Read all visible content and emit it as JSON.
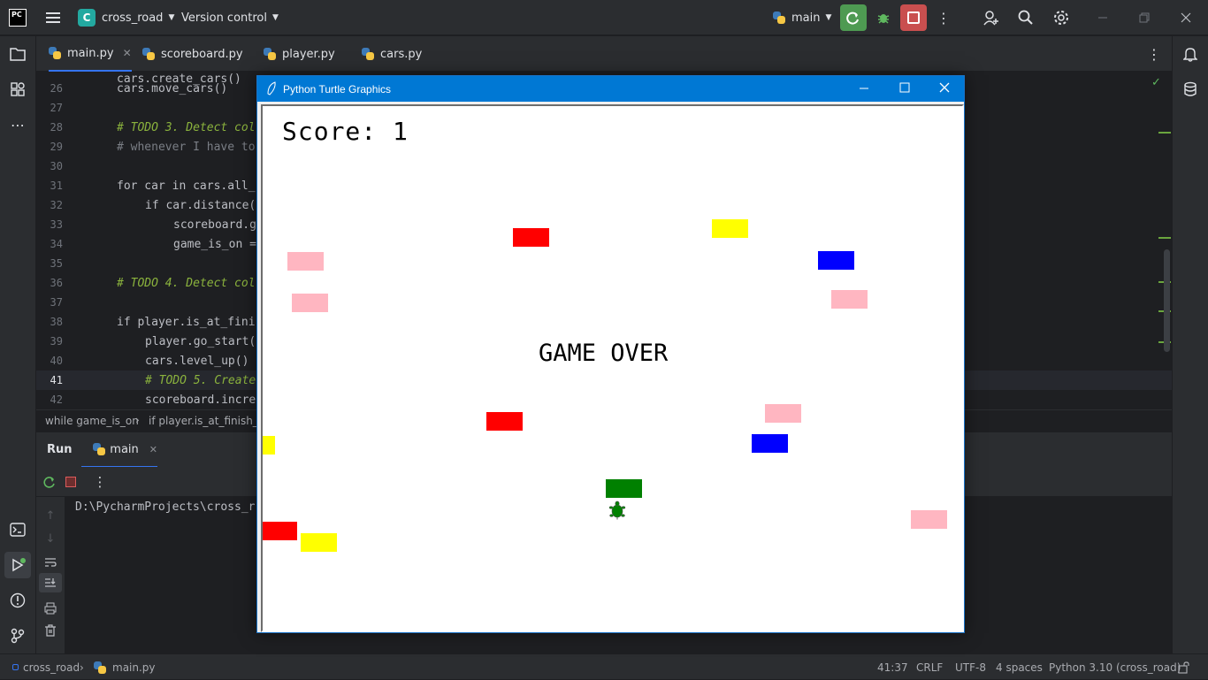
{
  "titlebar": {
    "app_badge": "PC",
    "project_badge": "C",
    "project_name": "cross_road",
    "vcs_label": "Version control",
    "run_config": "main"
  },
  "tabs": [
    {
      "label": "main.py",
      "active": true
    },
    {
      "label": "scoreboard.py"
    },
    {
      "label": "player.py"
    },
    {
      "label": "cars.py"
    }
  ],
  "editor": {
    "lines": [
      {
        "num": "26",
        "code": "cars.move_cars()"
      },
      {
        "num": "27",
        "code": ""
      },
      {
        "num": "28",
        "code": "# TODO 3. Detect col"
      },
      {
        "num": "29",
        "code": "# whenever I have to"
      },
      {
        "num": "30",
        "code": ""
      },
      {
        "num": "31",
        "code": "for car in cars.all_"
      },
      {
        "num": "32",
        "code": "if car.distance("
      },
      {
        "num": "33",
        "code": "scoreboard.g"
      },
      {
        "num": "34",
        "code": "game_is_on ="
      },
      {
        "num": "35",
        "code": ""
      },
      {
        "num": "36",
        "code": "# TODO 4. Detect col"
      },
      {
        "num": "37",
        "code": ""
      },
      {
        "num": "38",
        "code": "if player.is_at_fini"
      },
      {
        "num": "39",
        "code": "player.go_start("
      },
      {
        "num": "40",
        "code": "cars.level_up()"
      },
      {
        "num": "41",
        "code": "# TODO 5. Create"
      },
      {
        "num": "42",
        "code": "scoreboard.incre"
      }
    ]
  },
  "breadcrumb": {
    "item1": "while game_is_on",
    "item2": "if player.is_at_finish_line"
  },
  "run": {
    "tab_run": "Run",
    "tab_main": "main",
    "output": "D:\\PycharmProjects\\cross_r"
  },
  "turtle_window": {
    "title": "Python Turtle Graphics",
    "score": "Score: 1",
    "game_over": "GAME OVER",
    "cars": [
      {
        "color": "#ff0000"
      },
      {
        "color": "#ffff00"
      },
      {
        "color": "#ffb6c1"
      },
      {
        "color": "#0000ff"
      },
      {
        "color": "#ffb6c1"
      },
      {
        "color": "#ffb6c1"
      },
      {
        "color": "#ffb6c1"
      },
      {
        "color": "#ff0000"
      },
      {
        "color": "#ffff00"
      },
      {
        "color": "#0000ff"
      },
      {
        "color": "#008000"
      },
      {
        "color": "#ff0000"
      },
      {
        "color": "#ffff00"
      },
      {
        "color": "#ffb6c1"
      }
    ],
    "player_color": "#008000"
  },
  "statusbar": {
    "project": "cross_road",
    "file": "main.py",
    "position": "41:37",
    "line_sep": "CRLF",
    "encoding": "UTF-8",
    "indent": "4 spaces",
    "interpreter": "Python 3.10 (cross_road)"
  }
}
